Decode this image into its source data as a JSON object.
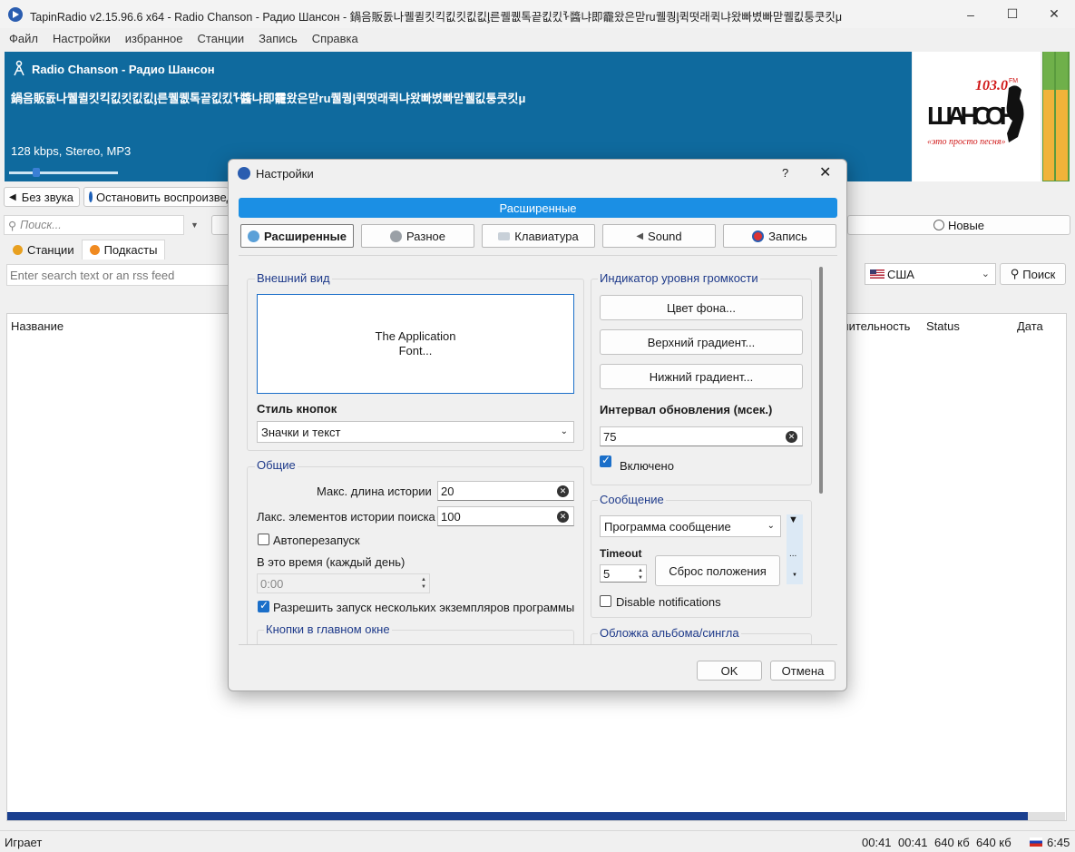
{
  "window": {
    "title": "TapinRadio v2.15.96.6   x64  - Radio Chanson - Радио Шансон - 鍋음販돐나퀠퀼킷킥킶킷킶킶ᶅ른퀠퀪톡끝킶킸ᠯ醬냐即靇왔은맏ru퀠퀑ᶅ퀵떳래퀵냐왔빠볐빠맏퀠킶퉁쿳킷μ",
    "minimize": "–",
    "maximize": "☐",
    "close": "✕"
  },
  "menu": [
    "Файл",
    "Настройки",
    "избранное",
    "Станции",
    "Запись",
    "Справка"
  ],
  "now_playing": {
    "station": "Radio Chanson - Радио Шансон",
    "track": "鍋음販돐나퀠퀼킷킥킶킷킶킶ᶅ른퀠퀪톡끝킶킸ᠯ醬냐即靇왔은맏ru퀠퀑ᶅ퀵떳래퀵냐왔빠볐빠맏퀠킶퉁쿳킷μ",
    "bitrate": "128 kbps, Stereo, MP3",
    "volume_fraction": 0.25,
    "logo_freq": "103.0",
    "logo_fm": "FM",
    "logo_name": "ШАНСОН",
    "logo_slogan": "«это просто песня»"
  },
  "controls": {
    "mute": "Без звука",
    "stop": "Остановить воспроизведение",
    "search_placeholder": "Поиск...",
    "new_button": "Новые"
  },
  "left_tabs": [
    "Станции",
    "Подкасты"
  ],
  "podcast": {
    "rss_placeholder": "Enter search text or an rss feed",
    "country": "США",
    "search_button": "Поиск"
  },
  "list_columns": [
    "Название",
    "лительность",
    "Status",
    "Дата"
  ],
  "progress_fraction": 0.965,
  "status": {
    "text": "Играет",
    "time1": "00:41",
    "time2": "00:41",
    "size1": "640 кб",
    "size2": "640 кб",
    "clock": "6:45"
  },
  "dialog": {
    "title": "Настройки",
    "help": "?",
    "close": "✕",
    "header": "Расширенные",
    "tabs": [
      "Расширенные",
      "Разное",
      "Клавиатура",
      "Sound",
      "Запись"
    ],
    "appearance": {
      "title": "Внешний вид",
      "font_line1": "The Application",
      "font_line2": "Font...",
      "button_style_label": "Стиль кнопок",
      "button_style_value": "Значки и текст"
    },
    "general": {
      "title": "Общие",
      "max_history_label": "Макс. длина истории",
      "max_history_value": "20",
      "max_search_label": "Лакс. элементов истории поиска",
      "max_search_value": "100",
      "autorestart_label": "Автоперезапуск",
      "time_label": "В это время (каждый день)",
      "time_value": "0:00",
      "multi_instance_label": "Разрешить запуск нескольких экземпляров программы",
      "main_buttons_title": "Кнопки в главном окне"
    },
    "volume_indicator": {
      "title": "Индикатор уровня громкости",
      "bg_color": "Цвет фона...",
      "top_gradient": "Верхний градиент...",
      "bottom_gradient": "Нижний градиент...",
      "interval_label": "Интервал обновления (мсек.)",
      "interval_value": "75",
      "enabled_label": "Включено"
    },
    "message": {
      "title": "Сообщение",
      "select_value": "Программа сообщение",
      "timeout_label": "Timeout",
      "timeout_value": "5",
      "reset_position": "Сброс положения",
      "ellipsis": "...",
      "disable_notifications": "Disable notifications"
    },
    "album_cover_title": "Обложка альбома/сингла",
    "ok": "OK",
    "cancel": "Отмена"
  }
}
